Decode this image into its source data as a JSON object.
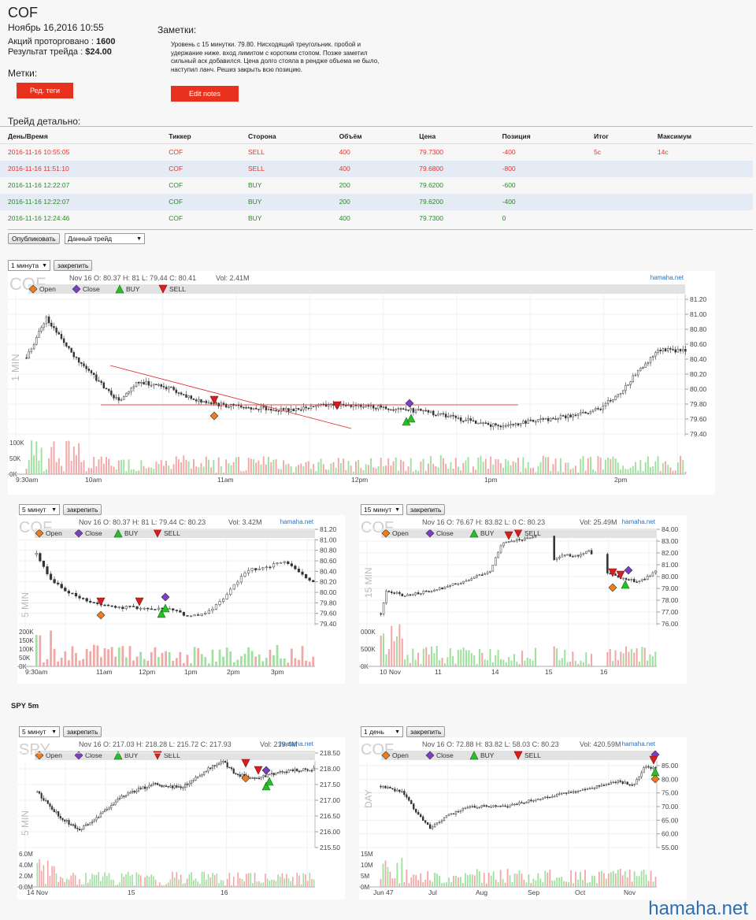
{
  "header": {
    "ticker": "COF",
    "date": "Ноябрь 16,2016 10:55",
    "shares_label": "Акций проторговано :",
    "shares_value": "1600",
    "result_label": "Результат трейда :",
    "result_value": "$24.00",
    "tags_label": "Метки:",
    "tags_button": "Ред. теги",
    "notes_label": "Заметки:",
    "notes_text": "Уровень с 15 минутки. 79.80. Нисходящий треугольник. пробой и удержание ниже. вход лимитом с коротким стопом. Позже заметил сильный аск добавился. Цена долго стояла в рендже объема не было, наступил ланч. Решиз закрыть всю позицию.",
    "notes_button": "Edit notes"
  },
  "trades": {
    "title": "Трейд детально:",
    "columns": [
      "День/Время",
      "Тиккер",
      "Сторона",
      "Объём",
      "Цена",
      "Позиция",
      "Итог",
      "Максимум"
    ],
    "rows": [
      {
        "time": "2016-11-16 10:55:05",
        "ticker": "COF",
        "side": "SELL",
        "volume": "400",
        "price": "79.7300",
        "position": "-400",
        "total": "5c",
        "max": "14c"
      },
      {
        "time": "2016-11-16 11:51:10",
        "ticker": "COF",
        "side": "SELL",
        "volume": "400",
        "price": "79.6800",
        "position": "-800",
        "total": "",
        "max": ""
      },
      {
        "time": "2016-11-16 12:22:07",
        "ticker": "COF",
        "side": "BUY",
        "volume": "200",
        "price": "79.6200",
        "position": "-600",
        "total": "",
        "max": ""
      },
      {
        "time": "2016-11-16 12:22:07",
        "ticker": "COF",
        "side": "BUY",
        "volume": "200",
        "price": "79.6200",
        "position": "-400",
        "total": "",
        "max": ""
      },
      {
        "time": "2016-11-16 12:24:46",
        "ticker": "COF",
        "side": "BUY",
        "volume": "400",
        "price": "79.7300",
        "position": "0",
        "total": "",
        "max": ""
      }
    ]
  },
  "controls": {
    "publish_button": "Опубликовать",
    "trade_select": "Данный трейд",
    "pin_button": "закрепить",
    "spy_section_title": "SPY 5m"
  },
  "legend": {
    "open": "Open",
    "close": "Close",
    "buy": "BUY",
    "sell": "SELL"
  },
  "colors": {
    "up": "#2a9a2a",
    "down": "#c8322a",
    "open_marker": "#ef7d1f",
    "close_marker": "#7a3fc4",
    "buy_marker": "#26c026",
    "sell_marker": "#d81e1e",
    "vol_up": "#9fe09f",
    "vol_down": "#f2a6a6",
    "link": "#2e6fb4"
  },
  "watermark": "hamaha.net",
  "charts": [
    {
      "id": "c1",
      "timeframe": "1 минута",
      "symbol": "COF",
      "side_label": "1 MIN",
      "info": "Nov 16 O: 80.37 H: 81 L: 79.44 C: 80.41",
      "vol": "Vol: 2.41M",
      "brand": "hamaha.net",
      "price_ticks": [
        "81.20",
        "81.00",
        "80.80",
        "80.60",
        "80.40",
        "80.20",
        "80.00",
        "79.80",
        "79.60",
        "79.40"
      ],
      "vol_ticks": [
        "100K",
        "50K",
        "0K"
      ],
      "x_ticks": [
        "9:30am",
        "10am",
        "11am",
        "12pm",
        "1pm",
        "2pm"
      ]
    },
    {
      "id": "c2",
      "timeframe": "5 минут",
      "symbol": "COF",
      "side_label": "5 MIN",
      "info": "Nov 16 O: 80.37 H: 81 L: 79.44 C: 80.23",
      "vol": "Vol: 3.42M",
      "brand": "hamaha.net",
      "price_ticks": [
        "81.20",
        "81.00",
        "80.80",
        "80.60",
        "80.40",
        "80.20",
        "80.00",
        "79.80",
        "79.60",
        "79.40"
      ],
      "vol_ticks": [
        "200K",
        "150K",
        "100K",
        "50K",
        "0K"
      ],
      "x_ticks": [
        "9:30am",
        "11am",
        "12pm",
        "1pm",
        "2pm",
        "3pm"
      ]
    },
    {
      "id": "c3",
      "timeframe": "15 минут",
      "symbol": "COF",
      "side_label": "15 MIN",
      "info": "Nov 16 O: 76.67 H: 83.82 L: 0 C: 80.23",
      "vol": "Vol: 25.49M",
      "brand": "hamaha.net",
      "price_ticks": [
        "84.00",
        "83.00",
        "82.00",
        "81.00",
        "80.00",
        "79.00",
        "78.00",
        "77.00",
        "76.00"
      ],
      "vol_ticks": [
        "000K",
        "500K",
        "0K"
      ],
      "x_ticks": [
        "10 Nov",
        "11",
        "14",
        "15",
        "16"
      ]
    },
    {
      "id": "c4",
      "timeframe": "5 минут",
      "symbol": "SPY",
      "side_label": "5 MIN",
      "info": "Nov 16 O: 217.03 H: 218.28 L: 215.72 C: 217.93",
      "vol": "Vol: 219.4M",
      "brand": "hamaha.net",
      "price_ticks": [
        "218.50",
        "218.00",
        "217.50",
        "217.00",
        "216.50",
        "216.00",
        "215.50"
      ],
      "vol_ticks": [
        "6.0M",
        "4.0M",
        "2.0M",
        "0.0M"
      ],
      "x_ticks": [
        "14 Nov",
        "15",
        "16"
      ]
    },
    {
      "id": "c5",
      "timeframe": "1 день",
      "symbol": "COF",
      "side_label": "DAY",
      "info": "Nov 16 O: 72.88 H: 83.82 L: 58.03 C: 80.23",
      "vol": "Vol: 420.59M",
      "brand": "hamaha.net",
      "price_ticks": [
        "85.00",
        "80.00",
        "75.00",
        "70.00",
        "65.00",
        "60.00",
        "55.00"
      ],
      "vol_ticks": [
        "15M",
        "10M",
        "5M",
        "0M"
      ],
      "x_ticks": [
        "Jun 47",
        "Jul",
        "Aug",
        "Sep",
        "Oct",
        "Nov"
      ]
    }
  ]
}
